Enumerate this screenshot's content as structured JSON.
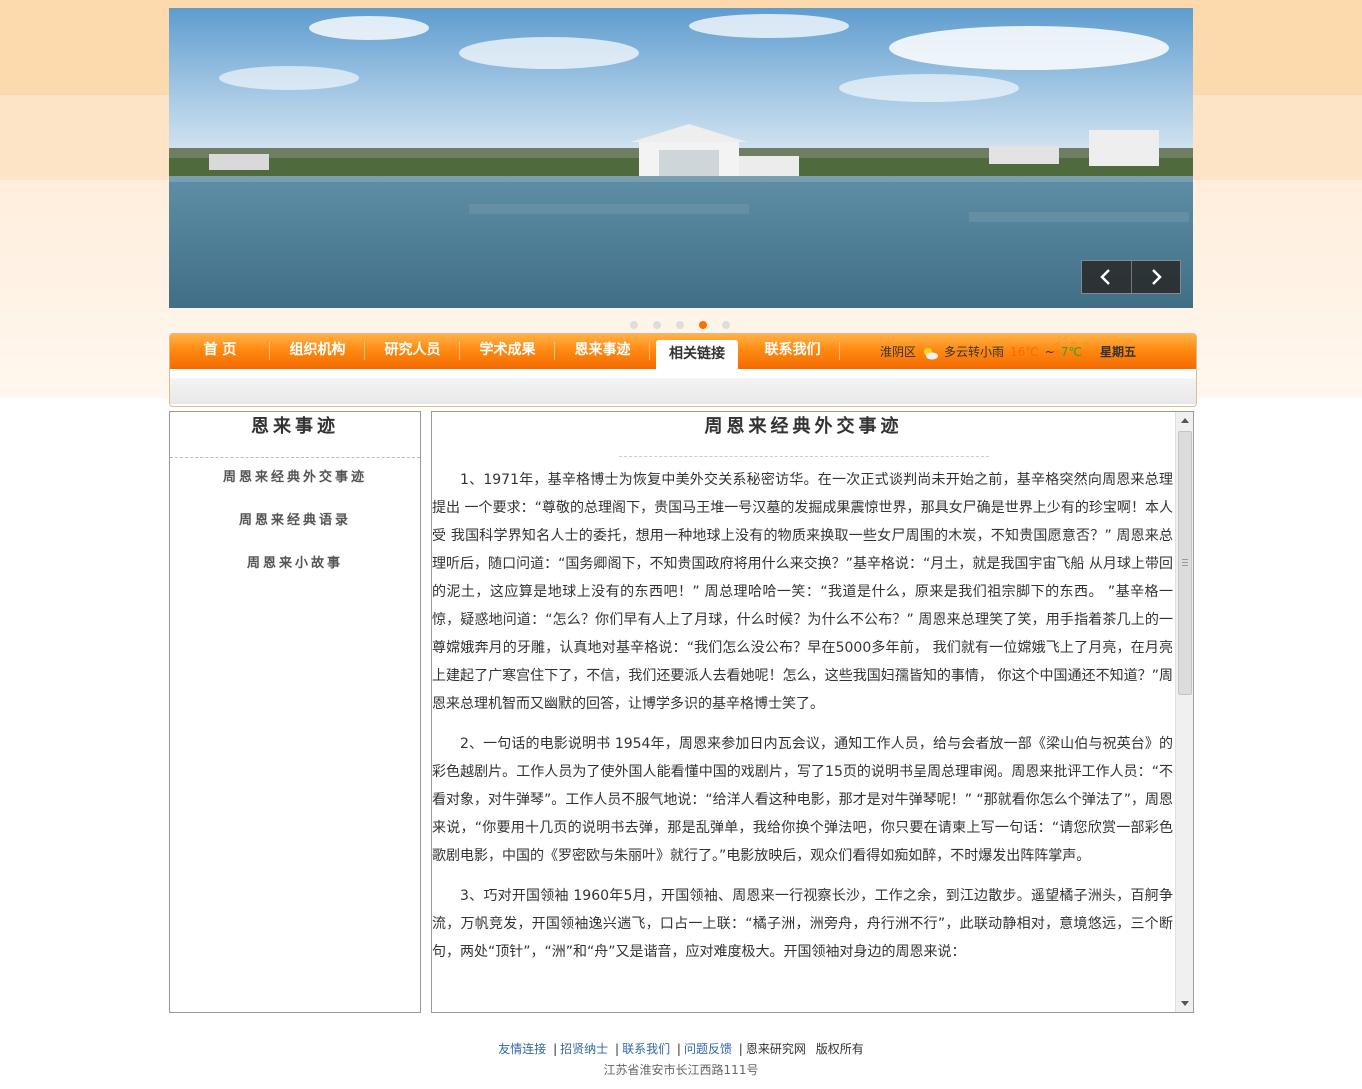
{
  "nav": {
    "items": [
      "首 页",
      "组织机构",
      "研究人员",
      "学术成果",
      "恩来事迹",
      "相关链接",
      "联系我们"
    ],
    "active_index": 5
  },
  "weather": {
    "district": "淮阴区",
    "condition": "多云转小雨",
    "high": "16℃",
    "tilde": "~",
    "low": "7℃",
    "weekday": "星期五"
  },
  "banner": {
    "slide_count": 5,
    "active_slide": 4
  },
  "sidebar": {
    "title": "恩来事迹",
    "items": [
      "周恩来经典外交事迹",
      "周恩来经典语录",
      "周恩来小故事"
    ]
  },
  "article": {
    "title": "周恩来经典外交事迹",
    "paragraphs": [
      "1、1971年，基辛格博士为恢复中美外交关系秘密访华。在一次正式谈判尚未开始之前，基辛格突然向周恩来总理提出 一个要求：“尊敬的总理阁下，贵国马王堆一号汉墓的发掘成果震惊世界，那具女尸确是世界上少有的珍宝啊！本人受 我国科学界知名人士的委托，想用一种地球上没有的物质来换取一些女尸周围的木炭，不知贵国愿意否？” 周恩来总理听后，随口问道：“国务卿阁下，不知贵国政府将用什么来交换？”基辛格说：“月土，就是我国宇宙飞船 从月球上带回的泥土，这应算是地球上没有的东西吧！” 周总理哈哈一笑：“我道是什么，原来是我们祖宗脚下的东西。 ”基辛格一惊，疑惑地问道：“怎么？你们早有人上了月球，什么时候？为什么不公布？” 周恩来总理笑了笑，用手指着茶几上的一尊嫦娥奔月的牙雕，认真地对基辛格说：“我们怎么没公布？早在5000多年前， 我们就有一位嫦娥飞上了月亮，在月亮上建起了广寒宫住下了，不信，我们还要派人去看她呢！怎么，这些我国妇孺皆知的事情， 你这个中国通还不知道？”周恩来总理机智而又幽默的回答，让博学多识的基辛格博士笑了。",
      "2、一句话的电影说明书 1954年，周恩来参加日内瓦会议，通知工作人员，给与会者放一部《梁山伯与祝英台》的彩色越剧片。工作人员为了使外国人能看懂中国的戏剧片，写了15页的说明书呈周总理审阅。周恩来批评工作人员：“不看对象，对牛弹琴”。工作人员不服气地说：“给洋人看这种电影，那才是对牛弹琴呢！” “那就看你怎么个弹法了”，周恩来说，“你要用十几页的说明书去弹，那是乱弹单，我给你换个弹法吧，你只要在请柬上写一句话：“请您欣赏一部彩色歌剧电影，中国的《罗密欧与朱丽叶》就行了。”电影放映后，观众们看得如痴如醉，不时爆发出阵阵掌声。",
      "3、巧对开国领袖 1960年5月，开国领袖、周恩来一行视察长沙，工作之余，到江边散步。遥望橘子洲头，百舸争流，万帆竞发，开国领袖逸兴遄飞，口占一上联：“橘子洲，洲旁舟，舟行洲不行”，此联动静相对，意境悠远，三个断句，两处“顶针”，“洲”和“舟”又是谐音，应对难度极大。开国领袖对身边的周恩来说："
    ]
  },
  "footer": {
    "links": [
      "友情连接",
      "招贤纳士",
      "联系我们",
      "问题反馈"
    ],
    "site": "恩来研究网",
    "copyright": "版权所有",
    "address": "江苏省淮安市长江西路111号"
  }
}
